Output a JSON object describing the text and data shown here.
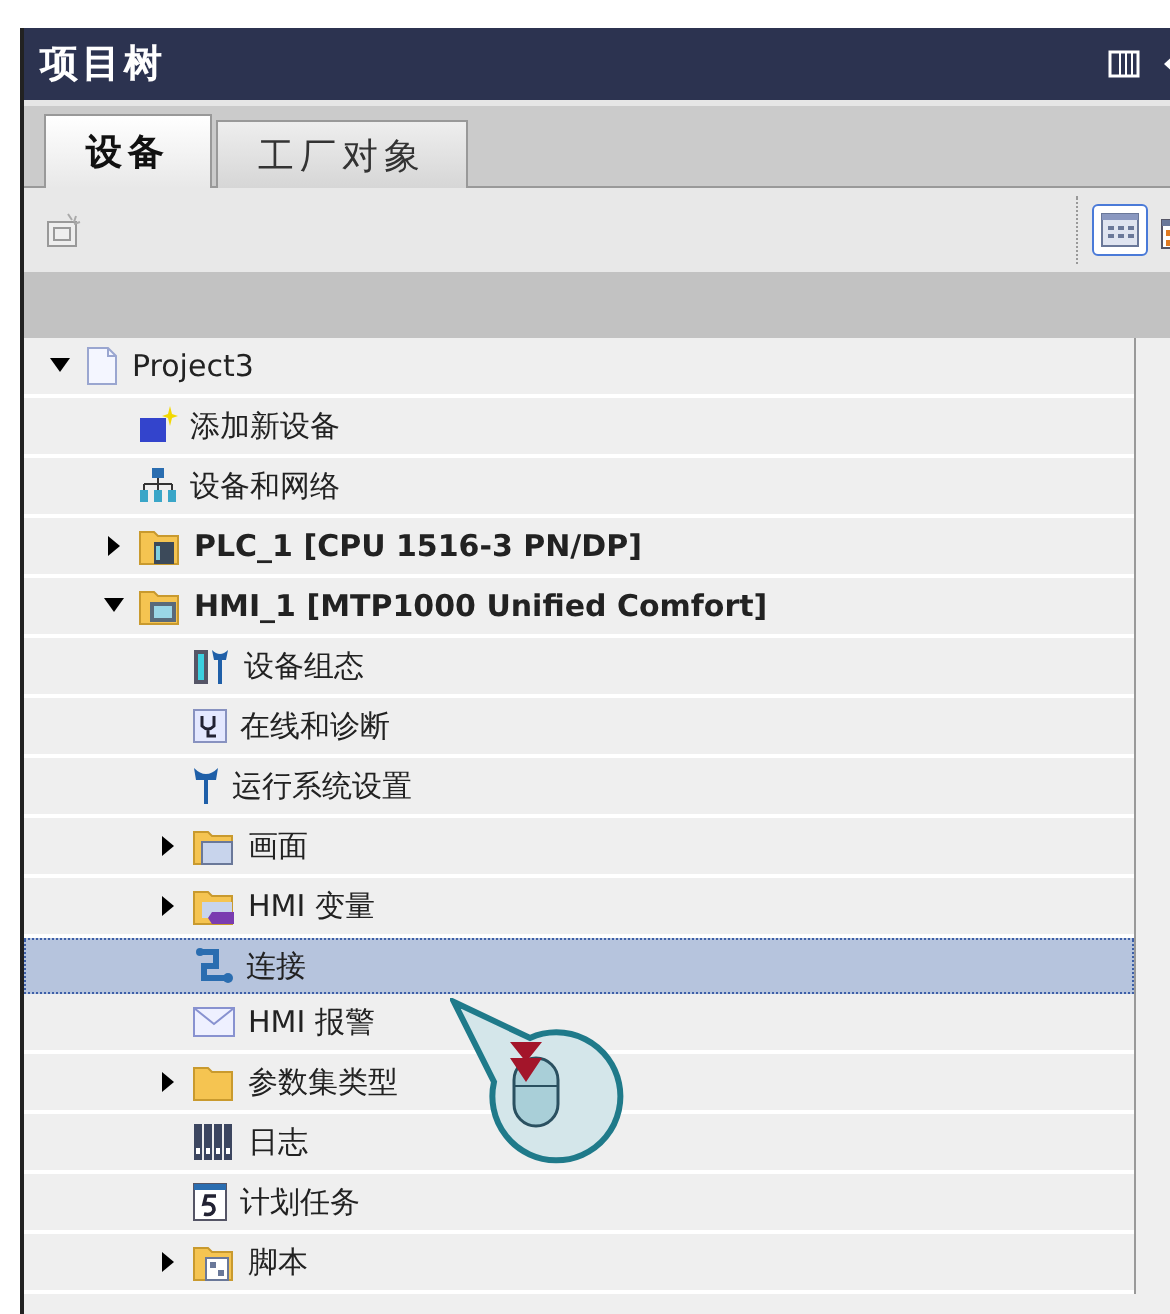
{
  "panel": {
    "title": "项目树"
  },
  "tabs": [
    {
      "label": "设备",
      "selected": true
    },
    {
      "label": "工厂对象",
      "selected": false
    }
  ],
  "tree": [
    {
      "label": "Project3",
      "kind": "project",
      "expanded": true,
      "children": [
        {
          "label": "添加新设备",
          "kind": "add-device",
          "selected": false
        },
        {
          "label": "设备和网络",
          "kind": "network",
          "selected": false
        },
        {
          "label": "PLC_1 [CPU 1516-3 PN/DP]",
          "kind": "plc",
          "expanded": false,
          "selected": false
        },
        {
          "label": "HMI_1 [MTP1000 Unified Comfort]",
          "kind": "hmi",
          "expanded": true,
          "selected": false,
          "children": [
            {
              "label": "设备组态",
              "kind": "config",
              "selected": false
            },
            {
              "label": "在线和诊断",
              "kind": "diagnostics",
              "selected": false
            },
            {
              "label": "运行系统设置",
              "kind": "wrench",
              "selected": false
            },
            {
              "label": "画面",
              "kind": "screens",
              "expanded": false,
              "selected": false
            },
            {
              "label": "HMI 变量",
              "kind": "tags",
              "expanded": false,
              "selected": false
            },
            {
              "label": "连接",
              "kind": "connection",
              "selected": true
            },
            {
              "label": "HMI 报警",
              "kind": "alarm",
              "selected": false
            },
            {
              "label": "参数集类型",
              "kind": "folder",
              "expanded": false,
              "selected": false
            },
            {
              "label": "日志",
              "kind": "logs",
              "selected": false
            },
            {
              "label": "计划任务",
              "kind": "calendar",
              "selected": false
            },
            {
              "label": "脚本",
              "kind": "scripts",
              "expanded": false,
              "selected": false
            }
          ]
        }
      ]
    }
  ]
}
